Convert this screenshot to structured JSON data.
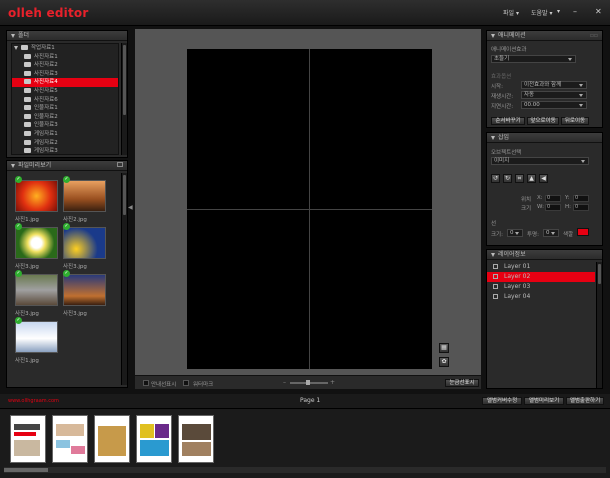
{
  "app": {
    "logo": "olleh editor"
  },
  "menu": {
    "file": "파일 ▾",
    "help": "도움말 ▾",
    "more": "▾"
  },
  "window": {
    "minimize": "–",
    "close": "✕"
  },
  "folders": {
    "title": "폴더",
    "root": "작업자료1",
    "items": [
      "사진자료1",
      "사진자료2",
      "사진자료3",
      "사진자료4",
      "사진자료5",
      "사진자료6",
      "인물자료1",
      "인물자료2",
      "인물자료3",
      "게임자료1",
      "게임자료2",
      "게임자료3"
    ],
    "selected_index": 3
  },
  "file_preview": {
    "title": "파일미리보기",
    "thumbs": [
      {
        "name": "사진1.jpg"
      },
      {
        "name": "사진2.jpg"
      },
      {
        "name": "사진3.jpg"
      },
      {
        "name": "사진3.jpg"
      },
      {
        "name": "사진3.jpg"
      },
      {
        "name": "사진3.jpg"
      },
      {
        "name": "사진1.jpg"
      }
    ]
  },
  "canvas_bottom": {
    "guide_label": "안내선표시",
    "watermark_label": "워터마크",
    "grid_button": "눈금선표시"
  },
  "status": {
    "url": "www.ollhgraam.com",
    "page": "Page 1",
    "buttons": [
      "앨범커버수정",
      "앨범미리보기",
      "앨범출판하기"
    ]
  },
  "animation": {
    "title": "애니메이션",
    "effect_label": "애니메이션효과",
    "effect_value": "초들기",
    "options_label": "효과옵션",
    "start_label": "시작:",
    "start_value": "이전효과와 함께",
    "play_label": "재생시간:",
    "play_value": "자동",
    "delay_label": "지연시간:",
    "delay_value": "00.00",
    "buttons": [
      "순서바꾸기",
      "앞으로이동",
      "뒤로이동"
    ]
  },
  "insert": {
    "title": "삽입",
    "object_label": "오브젝트선택",
    "object_value": "이미지",
    "pos_label": "위치",
    "x_label": "X:",
    "x_value": "0",
    "y_label": "Y:",
    "y_value": "0",
    "size_label": "크기",
    "w_label": "W:",
    "w_value": "0",
    "h_label": "H:",
    "h_value": "0",
    "line_label": "선",
    "thickness_label": "크기:",
    "thickness_value": "0",
    "opacity_label": "투명:",
    "opacity_value": "0",
    "color_label": "색깔",
    "line_color": "#e60012"
  },
  "layers": {
    "title": "레이어정보",
    "items": [
      "Layer 01",
      "Layer 02",
      "Layer 03",
      "Layer 04"
    ],
    "selected_index": 1
  },
  "colors": {
    "accent": "#e60012",
    "logo": "#e8212b"
  }
}
